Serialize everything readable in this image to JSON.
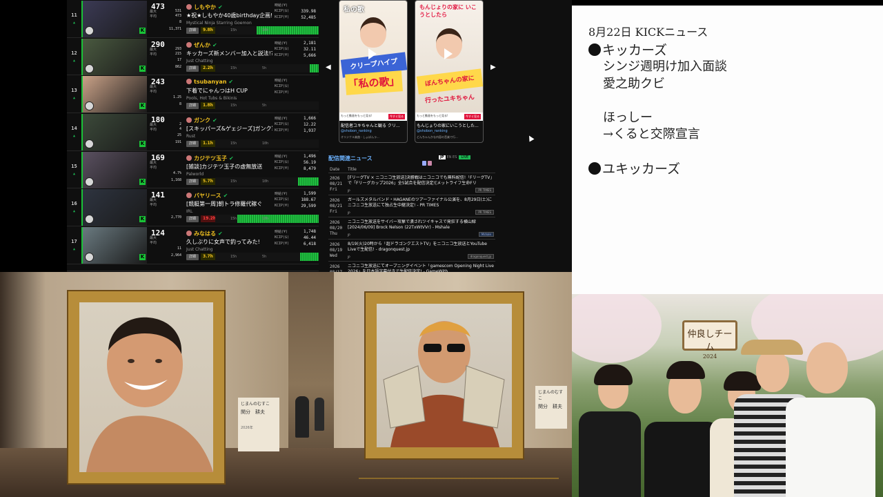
{
  "ranking": [
    {
      "rank": "11",
      "viewers": "473",
      "name": "しもやか",
      "title": "★祝★しもやか40歳birthday企画!",
      "category": "Mystical Ninja Starring Goemon",
      "duration": "9.8h",
      "stats": {
        "peak": "531",
        "avg": "473",
        "other": "8",
        "count": "11,371"
      },
      "kv": {
        "hours": "",
        "kcip_s": "339.98",
        "kcip_y": "52,485"
      },
      "t1": "15h",
      "t2": "10h",
      "fill": 0.62,
      "durred": false
    },
    {
      "rank": "12",
      "viewers": "290",
      "name": "ぜんか",
      "title": "キッカーズ新メンバー加入と説法!?",
      "category": "Just Chatting",
      "duration": "2.2h",
      "stats": {
        "peak": "293",
        "avg": "215",
        "other": "17",
        "count": "862"
      },
      "kv": {
        "hours": "2,181",
        "kcip_s": "32.11",
        "kcip_y": "5,666"
      },
      "t1": "15h",
      "t2": "5h",
      "fill": 0.13,
      "durred": false
    },
    {
      "rank": "13",
      "viewers": "243",
      "name": "tsubanyan",
      "title": "下着でにゃんつはH CUP",
      "category": "Pools, Hot Tubs & Bikinis",
      "duration": "1.8h",
      "stats": {
        "peak": "",
        "avg": "",
        "other": "1.25",
        "count": "8"
      },
      "kv": {
        "hours": "",
        "kcip_s": "",
        "kcip_y": ""
      },
      "t1": "15h",
      "t2": "5h",
      "fill": 0.0,
      "durred": false
    },
    {
      "rank": "14",
      "viewers": "180",
      "name": "ガンク",
      "title": "[スキッパーズ&ゲェジーズ]ガンク軍VS",
      "category": "Rust",
      "duration": "1.1h",
      "stats": {
        "peak": "2",
        "avg": "4",
        "other": "25",
        "count": "191"
      },
      "kv": {
        "hours": "1,666",
        "kcip_s": "12.22",
        "kcip_y": "1,937"
      },
      "t1": "15h",
      "t2": "10h",
      "fill": 0.0,
      "durred": false
    },
    {
      "rank": "15",
      "viewers": "169",
      "name": "カジテツ玉子",
      "title": "[雑談]カジテツ玉子の虚無放送",
      "category": "Palworld",
      "duration": "5.7h",
      "stats": {
        "peak": "",
        "avg": "",
        "other": "4.7%",
        "count": "1,168"
      },
      "kv": {
        "hours": "1,496",
        "kcip_s": "56.19",
        "kcip_y": "8,479"
      },
      "t1": "15h",
      "t2": "10h",
      "fill": 0.24,
      "durred": false
    },
    {
      "rank": "16",
      "viewers": "141",
      "name": "バヤリース",
      "title": "[競艇第一周]朝トラ修羅代稼ぐ",
      "category": "IRL",
      "duration": "19.2h",
      "stats": {
        "peak": "",
        "avg": "",
        "other": "",
        "count": "2,770"
      },
      "kv": {
        "hours": "1,599",
        "kcip_s": "188.67",
        "kcip_y": "29,599"
      },
      "t1": "15h",
      "t2": "10h",
      "fill": 0.8,
      "durred": true
    },
    {
      "rank": "17",
      "viewers": "124",
      "name": "みなはる",
      "title": "久しぶりに女声で釣ってみた!",
      "category": "Just Chatting",
      "duration": "3.7h",
      "stats": {
        "peak": "",
        "avg": "",
        "other": "11",
        "count": "2,964"
      },
      "kv": {
        "hours": "1,748",
        "kcip_s": "46.44",
        "kcip_y": "6,418"
      },
      "t1": "15h",
      "t2": "5h",
      "fill": 0.22,
      "durred": false
    }
  ],
  "rank_labels": {
    "peak": "最大",
    "avg": "平均",
    "other": "",
    "kv_hours": "時給(¥)",
    "kv_s": "KCIP($)",
    "kv_y": "KCIP(¥)",
    "detail": "詳細"
  },
  "shorts": [
    {
      "head": "私の歌",
      "banner": "クリープハイプ",
      "banner2": "「私の歌」",
      "adtext": "もっと動画をもっと見る!",
      "adbtn": "今すぐ見る",
      "caption": "配信者ユキちゃんと観る クリ...",
      "channel": "@shobon_ranking",
      "sound": "オリジナル楽曲 - しょぼんラ..."
    },
    {
      "head": "もんじょりの家に いこうとしたら",
      "banner": "ぼんちゃんの家に",
      "banner2": "行ったユキちゃん",
      "adtext": "もっと動画をもっと見る!",
      "adbtn": "今すぐ見る",
      "caption": "もんじょりの家にいこうとした...",
      "channel": "@shobon_ranking",
      "sound": "どんちゃんかな内容の音楽で行..."
    }
  ],
  "news": {
    "title": "配信関連ニュース",
    "langs": [
      "JP",
      "EN",
      "ES"
    ],
    "live_badge": "LIVE",
    "col_date": "Date",
    "col_title": "Title",
    "rows": [
      {
        "date": "2026\n08/21\nFri",
        "title": "[FリーグTV × ニコニコ生放送]決勝戦はニコニコでも無料配信!「FリーグTV」で「Fリーグカップ2026」全5試合を配信決定![メットライフ生命Fリ",
        "source": "PR TIMES",
        "lang": "JP",
        "hl": false
      },
      {
        "date": "2026\n08/21\nFri",
        "title": "ガールズメタルバンド・HAGANEのツアーファイナル公演を、8月29日(土)にニコニコ生放送にて独占生中継決定! - PR TIMES",
        "source": "PR TIMES",
        "lang": "JP",
        "hl": false
      },
      {
        "date": "2026\n08/20\nThu",
        "title": "ニコニコ生放送をサイバー攻撃で潰されツイキャスで発狂する横山緑 [2024/06/09] Brock Nelson (22TxWtVVr) - Mshale",
        "source": "Mshale",
        "lang": "JP",
        "hl": true
      },
      {
        "date": "2026\n08/19\nWed",
        "title": "8/19(火)20時から「超ドラゴンクエストTV」をニコニコ生放送とYouTube Liveで生配信! - dragonquest.jp",
        "source": "dragonquest.jp",
        "lang": "JP",
        "hl": false
      },
      {
        "date": "2026\n08/17",
        "title": "ニコニコ生放送にてオープニングイベント「gamescom Opening Night Live 2026」を日本語字幕付きで生配信決定! - GameWith",
        "source": "",
        "lang": "",
        "hl": false
      }
    ]
  },
  "memo": {
    "date_line": "8月22日 KICKニュース",
    "head1": "キッカーズ",
    "line1": "シンジ週明け加入面談",
    "line2": "愛之助クビ",
    "line3": "ほっしー",
    "line4": "→くると交際宣言",
    "head2": "ユキッカーズ"
  },
  "gallery": {
    "plaque1": {
      "l1": "じまんのむすこ",
      "l2": "関分　耕夫",
      "l3": "2026年"
    },
    "plaque2": {
      "l1": "じまんのむすこ",
      "l2": "関分　耕夫",
      "l3": ""
    }
  },
  "photo": {
    "sign_top": "仲良しチーム",
    "sign_year": "2024"
  },
  "colors": {
    "accent_green": "#19c337",
    "news_blue": "#6db3ff",
    "frame_gold": "#b78d3a"
  }
}
